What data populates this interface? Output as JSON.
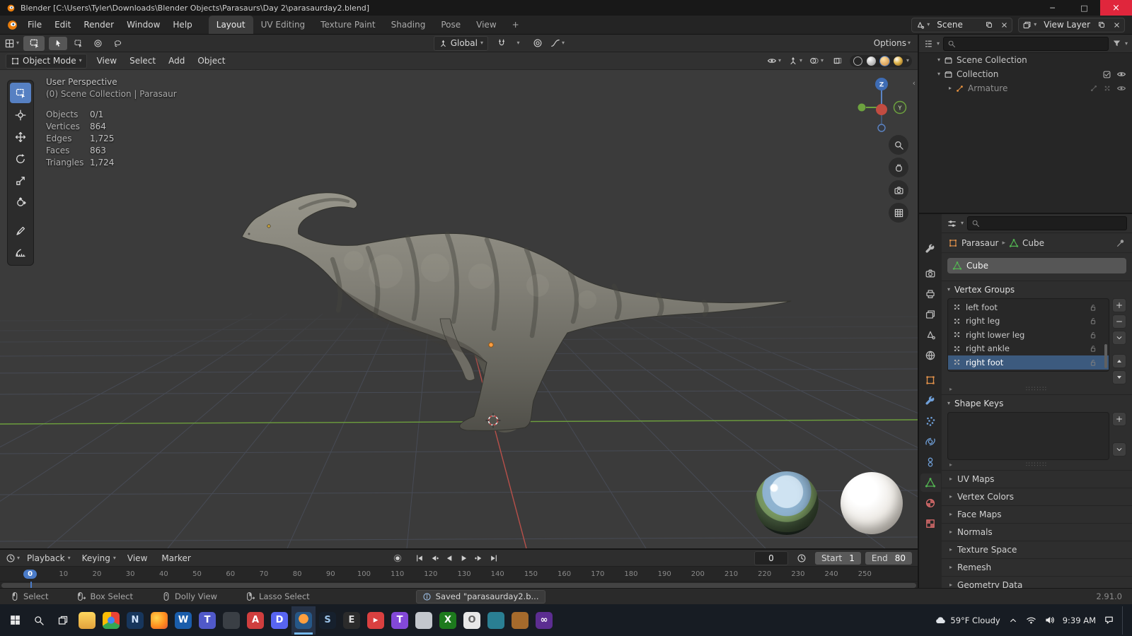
{
  "window": {
    "title": "Blender [C:\\Users\\Tyler\\Downloads\\Blender Objects\\Parasaurs\\Day 2\\parasaurday2.blend]",
    "minimize": "─",
    "maximize": "□",
    "close": "×"
  },
  "topbar": {
    "menus": [
      "File",
      "Edit",
      "Render",
      "Window",
      "Help"
    ],
    "workspaces": [
      {
        "label": "Layout",
        "active": true
      },
      {
        "label": "UV Editing"
      },
      {
        "label": "Texture Paint"
      },
      {
        "label": "Shading"
      },
      {
        "label": "Pose"
      },
      {
        "label": "View"
      },
      {
        "label": "+"
      }
    ],
    "scene_name": "Scene",
    "view_layer_name": "View Layer"
  },
  "tool_settings": {
    "orientation": "Global",
    "options": "Options"
  },
  "viewport_header": {
    "mode": "Object Mode",
    "menus": [
      "View",
      "Select",
      "Add",
      "Object"
    ]
  },
  "viewport": {
    "view_label": "User Perspective",
    "context_label": "(0) Scene Collection | Parasaur",
    "stats": [
      {
        "label": "Objects",
        "value": "0/1"
      },
      {
        "label": "Vertices",
        "value": "864"
      },
      {
        "label": "Edges",
        "value": "1,725"
      },
      {
        "label": "Faces",
        "value": "863"
      },
      {
        "label": "Triangles",
        "value": "1,724"
      }
    ],
    "axis_z": "Z",
    "axis_y": "Y",
    "collapse_arrow": "‹",
    "tools": [
      {
        "icon": "select-box",
        "active": true
      },
      {
        "icon": "cursor"
      },
      {
        "icon": "move"
      },
      {
        "icon": "rotate"
      },
      {
        "icon": "scale"
      },
      {
        "icon": "transform"
      },
      {
        "icon": "annotate"
      },
      {
        "icon": "measure"
      }
    ]
  },
  "outliner": {
    "items": [
      {
        "label": "Scene Collection"
      },
      {
        "label": "Collection"
      },
      {
        "label": "Armature"
      }
    ]
  },
  "properties": {
    "tabs": [
      {
        "icon": "tool",
        "color": "#b8b8b8"
      },
      {
        "icon": "render",
        "color": "#b8b8b8"
      },
      {
        "icon": "output",
        "color": "#b8b8b8"
      },
      {
        "icon": "view-layer",
        "color": "#b8b8b8"
      },
      {
        "icon": "scene",
        "color": "#b8b8b8"
      },
      {
        "icon": "world",
        "color": "#b8b8b8"
      },
      {
        "icon": "object",
        "color": "#e0904a"
      },
      {
        "icon": "wrench",
        "color": "#6f9fd8"
      },
      {
        "icon": "particles",
        "color": "#6f9fd8"
      },
      {
        "icon": "physics",
        "color": "#6f9fd8"
      },
      {
        "icon": "constraints",
        "color": "#6f9fd8"
      },
      {
        "icon": "object-data",
        "color": "#53b552",
        "active": true
      },
      {
        "icon": "material",
        "color": "#d66a6a"
      },
      {
        "icon": "texture",
        "color": "#d66a6a"
      }
    ],
    "breadcrumb": {
      "object": "Parasaur",
      "data": "Cube"
    },
    "datablock_name": "Cube",
    "vertex_groups": {
      "title": "Vertex Groups",
      "items": [
        {
          "name": "left foot"
        },
        {
          "name": "right leg"
        },
        {
          "name": "right lower leg"
        },
        {
          "name": "right ankle"
        },
        {
          "name": "right foot",
          "active": true
        }
      ]
    },
    "shape_keys": {
      "title": "Shape Keys"
    },
    "collapsed_panels": [
      {
        "title": "UV Maps"
      },
      {
        "title": "Vertex Colors"
      },
      {
        "title": "Face Maps"
      },
      {
        "title": "Normals"
      },
      {
        "title": "Texture Space"
      },
      {
        "title": "Remesh"
      },
      {
        "title": "Geometry Data"
      }
    ]
  },
  "timeline": {
    "menus": [
      {
        "label": "Playback",
        "caret": "▾"
      },
      {
        "label": "Keying",
        "caret": "▾"
      },
      {
        "label": "View",
        "caret": ""
      },
      {
        "label": "Marker",
        "caret": ""
      }
    ],
    "current_frame": "0",
    "start_label": "Start",
    "start_value": "1",
    "end_label": "End",
    "end_value": "80",
    "ruler": [
      {
        "label": "0",
        "current": true
      },
      {
        "label": "10"
      },
      {
        "label": "20"
      },
      {
        "label": "30"
      },
      {
        "label": "40"
      },
      {
        "label": "50"
      },
      {
        "label": "60"
      },
      {
        "label": "70"
      },
      {
        "label": "80"
      },
      {
        "label": "90"
      },
      {
        "label": "100"
      },
      {
        "label": "110"
      },
      {
        "label": "120"
      },
      {
        "label": "130"
      },
      {
        "label": "140"
      },
      {
        "label": "150"
      },
      {
        "label": "160"
      },
      {
        "label": "170"
      },
      {
        "label": "180"
      },
      {
        "label": "190"
      },
      {
        "label": "200"
      },
      {
        "label": "210"
      },
      {
        "label": "220"
      },
      {
        "label": "230"
      },
      {
        "label": "240"
      },
      {
        "label": "250"
      }
    ]
  },
  "statusbar": {
    "hints": [
      {
        "icon": "mouse-l",
        "label": "Select"
      },
      {
        "icon": "mouse-l-drag",
        "label": "Box Select"
      },
      {
        "icon": "mouse-m",
        "label": "Dolly View"
      },
      {
        "icon": "mouse-r-drag",
        "label": "Lasso Select"
      }
    ],
    "notification": "Saved \"parasaurday2.b...",
    "version": "2.91.0"
  },
  "taskbar": {
    "weather": "59°F Cloudy",
    "time": "9:39 AM",
    "apps": [
      {
        "name": "file-explorer",
        "color": "linear-gradient(180deg,#ffd75e,#e2a23c)",
        "glyph": "",
        "fg": "#ffffff"
      },
      {
        "name": "chrome",
        "color": "conic-gradient(#ea4335 0 33%,#34a853 0 66%,#fbbc05 0 100%)",
        "glyph": "●",
        "fg": "#4285f4"
      },
      {
        "name": "app-navy",
        "color": "#17365c",
        "glyph": "N",
        "fg": "#cfe3ff"
      },
      {
        "name": "firefox",
        "color": "radial-gradient(circle at 35% 35%,#ffd54f,#ff8f1f 55%,#e3542f)",
        "glyph": "",
        "fg": "#ffffff"
      },
      {
        "name": "word",
        "color": "#1a5dab",
        "glyph": "W",
        "fg": "#ffffff"
      },
      {
        "name": "teams",
        "color": "#5059c9",
        "glyph": "T",
        "fg": "#ffffff"
      },
      {
        "name": "app-slate",
        "color": "#3a3f45",
        "glyph": "",
        "fg": "#ffffff"
      },
      {
        "name": "app-red",
        "color": "#cf3e3e",
        "glyph": "A",
        "fg": "#ffffff"
      },
      {
        "name": "discord",
        "color": "#5865f2",
        "glyph": "D",
        "fg": "#ffffff"
      },
      {
        "name": "blender",
        "color": "radial-gradient(circle at 50% 40%,#ff9f3e 0 36%,#265787 37% 100%)",
        "glyph": "",
        "fg": "#ffffff",
        "active": true
      },
      {
        "name": "steam",
        "color": "#16202d",
        "glyph": "S",
        "fg": "#9cc3e8"
      },
      {
        "name": "app-dark",
        "color": "#2b2b2b",
        "glyph": "E",
        "fg": "#dddddd"
      },
      {
        "name": "youtube",
        "color": "#d94040",
        "glyph": "▸",
        "fg": "#ffffff"
      },
      {
        "name": "twitch",
        "color": "#8348d8",
        "glyph": "T",
        "fg": "#ffffff"
      },
      {
        "name": "app-silver",
        "color": "#c3c7cd",
        "glyph": "",
        "fg": "#444444"
      },
      {
        "name": "xbox",
        "color": "#1d7a1d",
        "glyph": "X",
        "fg": "#ffffff"
      },
      {
        "name": "app-white",
        "color": "#e8e8e8",
        "glyph": "O",
        "fg": "#666666"
      },
      {
        "name": "app-teal",
        "color": "#2a7f93",
        "glyph": "",
        "fg": "#ffffff"
      },
      {
        "name": "app-amber",
        "color": "#a56a2c",
        "glyph": "",
        "fg": "#ffffff"
      },
      {
        "name": "visual-studio",
        "color": "#5c2d91",
        "glyph": "∞",
        "fg": "#ffffff"
      }
    ]
  }
}
